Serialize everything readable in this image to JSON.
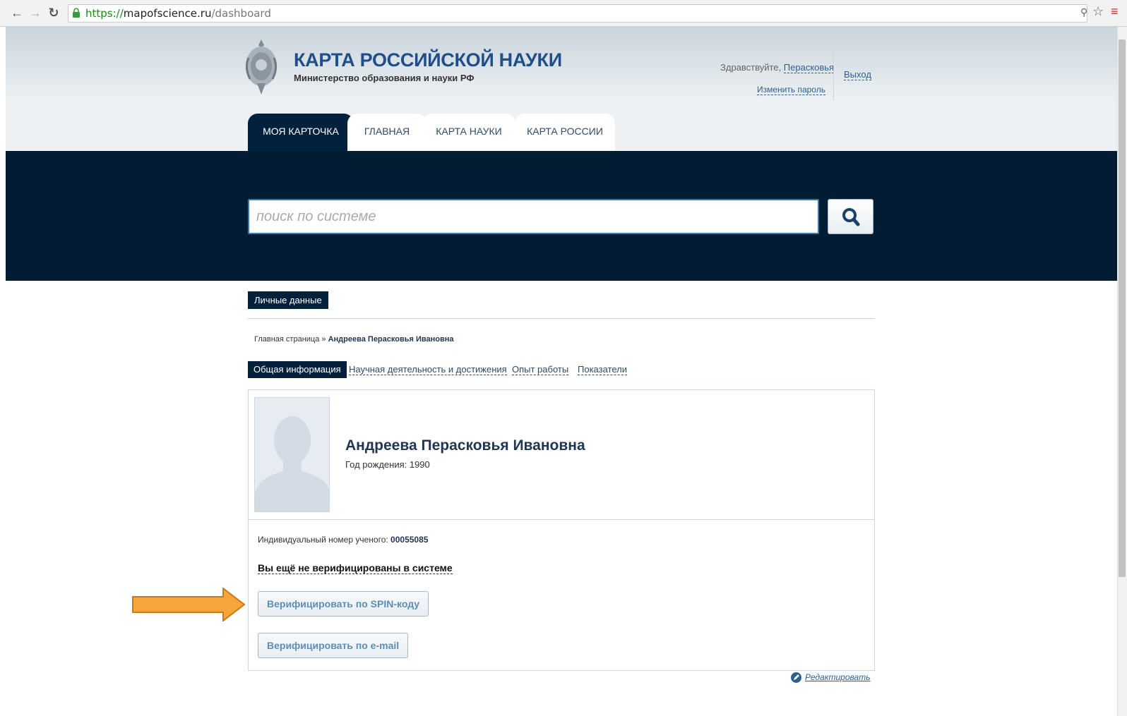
{
  "browser": {
    "url_scheme": "https://",
    "url_host": "mapofscience.ru",
    "url_path": "/dashboard"
  },
  "header": {
    "brand_title": "КАРТА РОССИЙСКОЙ НАУКИ",
    "brand_subtitle": "Министерство образования и науки РФ",
    "greeting_prefix": "Здравствуйте,",
    "user_name": "Перасковья",
    "change_password": "Изменить пароль",
    "logout": "Выход"
  },
  "tabs": [
    {
      "label": "МОЯ КАРТОЧКА"
    },
    {
      "label": "ГЛАВНАЯ"
    },
    {
      "label": "КАРТА НАУКИ"
    },
    {
      "label": "КАРТА РОССИИ"
    }
  ],
  "search": {
    "placeholder": "поиск по системе"
  },
  "main": {
    "section_tag": "Личные данные",
    "breadcrumb_home": "Главная страница",
    "breadcrumb_sep": "»",
    "breadcrumb_current": "Андреева Перасковья Ивановна",
    "subtabs": [
      {
        "label": "Общая информация"
      },
      {
        "label": "Научная деятельность и достижения"
      },
      {
        "label": "Опыт работы"
      },
      {
        "label": "Показатели"
      }
    ],
    "person_name": "Андреева Перасковья Ивановна",
    "birth_year_label": "Год рождения: 1990",
    "scientist_id_label": "Индивидуальный номер ученого:",
    "scientist_id": "00055085",
    "unverified_text": "Вы ещё не верифицированы в системе",
    "verify_spin": "Верифицировать по SPIN-коду",
    "verify_email": "Верифицировать по e-mail",
    "edit_link": "Редактировать"
  },
  "colors": {
    "dark_navy": "#03203c",
    "brand_blue": "#1f4e8a",
    "annotation_arrow": "#f0a030"
  }
}
